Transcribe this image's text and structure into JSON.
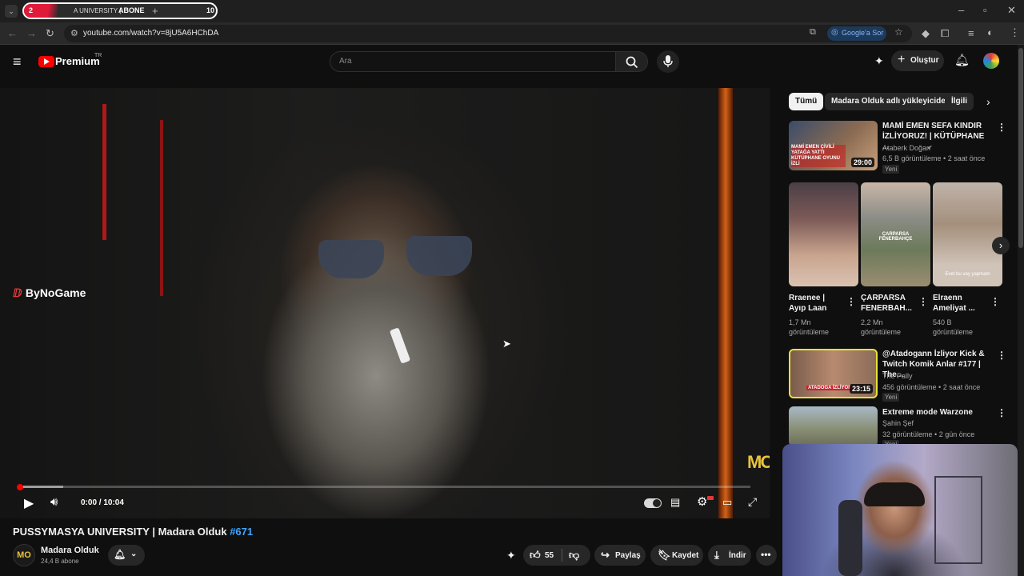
{
  "browser": {
    "tab_label_prefix": "A UNIVERSITY |",
    "tab_label_bold": "ABONE",
    "tab_badge_left": "2",
    "tab_badge_right": "10",
    "url": "youtube.com/watch?v=8jU5A6HChDA",
    "google_lens_label": "Google'a Sor"
  },
  "header": {
    "logo_text": "Premium",
    "region": "TR",
    "search_placeholder": "Ara",
    "create_label": "Oluştur"
  },
  "player": {
    "watermark_left": "ByNoGame",
    "watermark_right": "MO",
    "time": "0:00 / 10:04",
    "progress_fraction": 0.0,
    "buffered_fraction": 0.06
  },
  "video": {
    "title": "PUSSYMASYA UNIVERSITY | Madara Olduk",
    "hashtag": "#671",
    "channel_name": "Madara Olduk",
    "channel_subs": "24,4 B abone",
    "channel_avatar_text": "MO",
    "likes": "55",
    "share_label": "Paylaş",
    "save_label": "Kaydet",
    "download_label": "İndir"
  },
  "chips": [
    "Tümü",
    "Madara Olduk adlı yükleyiciden",
    "İlgili"
  ],
  "recommendations": [
    {
      "title": "MAMİ EMEN SEFA KINDIR İZLİYORUZ! | KÜTÜPHANE ...",
      "channel": "Ataberk Doğan",
      "meta": "6,5 B görüntüleme • 2 saat önce",
      "badge": "Yeni",
      "duration": "29:00",
      "thumb_text": "MAMİ EMEN ÇİVİLİ YATAĞA YATTI KÜTÜPHANE OYUNU İZLİ"
    },
    {
      "title": "@Atadogann İzliyor Kick & Twitch Komik Anlar #177 | The...",
      "channel": "The Pally",
      "meta": "456 görüntüleme • 2 saat önce",
      "badge": "Yeni",
      "duration": "23:15",
      "thumb_text": "ATADOGA İZLİYOR"
    },
    {
      "title": "Extreme mode Warzone",
      "channel": "Şahin Şef",
      "meta": "32 görüntüleme • 2 gün önce",
      "badge": "Yeni",
      "duration": "",
      "thumb_text": ""
    }
  ],
  "shorts": [
    {
      "title": "Rraenee | Ayıp Laan",
      "views": "1,7 Mn görüntüleme"
    },
    {
      "title": "ÇARPARSA FENERBAH...",
      "views": "2,2 Mn görüntüleme"
    },
    {
      "title": "Elraenn Ameliyat ...",
      "views": "540 B görüntüleme"
    }
  ],
  "shorts_captions": [
    "ÇARPARSA FENERBAHÇE",
    "Evet bu vay yapmam"
  ],
  "colors": {
    "accent": "#ff0000",
    "link": "#3ea6ff",
    "background": "#0f0f0f",
    "chip": "#272727"
  }
}
